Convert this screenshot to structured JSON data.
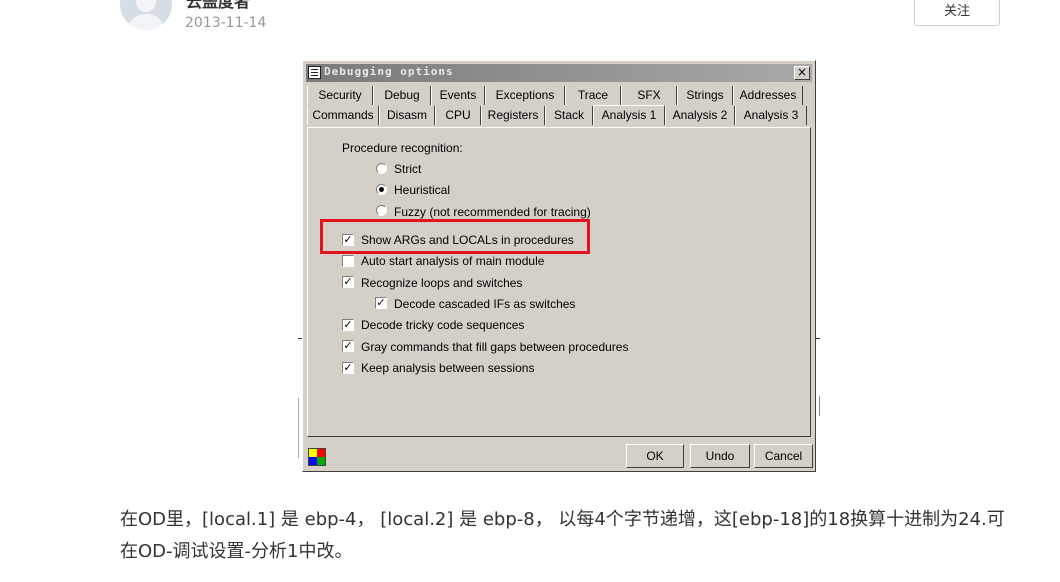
{
  "header": {
    "author": "云盖度者",
    "date": "2013-11-14",
    "follow_label": "关注"
  },
  "dialog": {
    "title": "Debugging options",
    "close_label": "×",
    "tabs_row1": [
      "Security",
      "Debug",
      "Events",
      "Exceptions",
      "Trace",
      "SFX",
      "Strings",
      "Addresses"
    ],
    "tabs_row2": [
      "Commands",
      "Disasm",
      "CPU",
      "Registers",
      "Stack",
      "Analysis 1",
      "Analysis 2",
      "Analysis 3"
    ],
    "active_tab": "Analysis 1",
    "procedure_label": "Procedure recognition:",
    "radios": [
      {
        "label": "Strict",
        "checked": false
      },
      {
        "label": "Heuristical",
        "checked": true
      },
      {
        "label": "Fuzzy (not recommended for tracing)",
        "checked": false
      }
    ],
    "checkboxes": [
      {
        "label": "Show ARGs and LOCALs in procedures",
        "checked": true
      },
      {
        "label": "Auto start analysis of main module",
        "checked": false
      },
      {
        "label": "Recognize loops and switches",
        "checked": true
      },
      {
        "label": "Decode cascaded IFs as switches",
        "checked": true
      },
      {
        "label": "Decode tricky code sequences",
        "checked": true
      },
      {
        "label": "Gray commands that fill gaps between procedures",
        "checked": true
      },
      {
        "label": "Keep analysis between sessions",
        "checked": true
      }
    ],
    "buttons": {
      "ok": "OK",
      "undo": "Undo",
      "cancel": "Cancel"
    },
    "highlight_color": "#e0141e"
  },
  "article": {
    "paragraph": "在OD里，[local.1] 是 ebp-4， [local.2] 是 ebp-8， 以每4个字节递增，这[ebp-18]的18换算十进制为24.可在OD-调试设置-分析1中改。"
  }
}
